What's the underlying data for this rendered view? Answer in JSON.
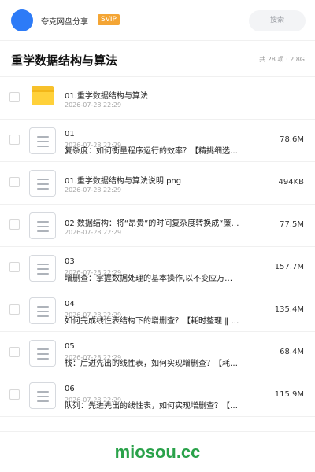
{
  "header": {
    "app_name": "夸克网盘分享",
    "badge": "SVIP",
    "search_placeholder": "搜索"
  },
  "folder": {
    "title": "重学数据结构与算法",
    "summary": "共 28 项 · 2.8G"
  },
  "files": [
    {
      "type": "folder",
      "name": "01.重学数据结构与算法",
      "date": "2026-07-28 22:29",
      "size": ""
    },
    {
      "type": "file",
      "name": "01",
      "name2": "复杂度：如何衡量程序运行的效率？【精挑细选…",
      "date": "2026-07-28 22:29",
      "size": "78.6M"
    },
    {
      "type": "file",
      "name": "01.重学数据结构与算法说明.png",
      "date": "2026-07-28 22:29",
      "size": "494KB"
    },
    {
      "type": "file",
      "name": "02  数据结构：将“昂贵”的时间复杂度转换成“廉…",
      "date": "2026-07-28 22:29",
      "size": "77.5M"
    },
    {
      "type": "file",
      "name": "03",
      "name2": "增删查：掌握数据处理的基本操作,以不变应万…",
      "date": "2026-07-28 22:29",
      "size": "157.7M"
    },
    {
      "type": "file",
      "name": "04",
      "name2": "如何完成线性表结构下的增删查？【耗时整理 ‖ …",
      "date": "2026-07-28 22:29",
      "size": "135.4M"
    },
    {
      "type": "file",
      "name": "05",
      "name2": "栈：后进先出的线性表，如何实现增删查？【耗…",
      "date": "2026-07-28 22:29",
      "size": "68.4M"
    },
    {
      "type": "file",
      "name": "06",
      "name2": "队列：先进先出的线性表，如何实现增删查？【…",
      "date": "2026-07-28 22:29",
      "size": "115.9M"
    }
  ],
  "footer": {
    "brand": "miosou.cc"
  },
  "colors": {
    "avatar": "#2d7bf7",
    "badge": "#f4a534",
    "folder": "#ffd13a",
    "brand": "#2aa24a"
  }
}
